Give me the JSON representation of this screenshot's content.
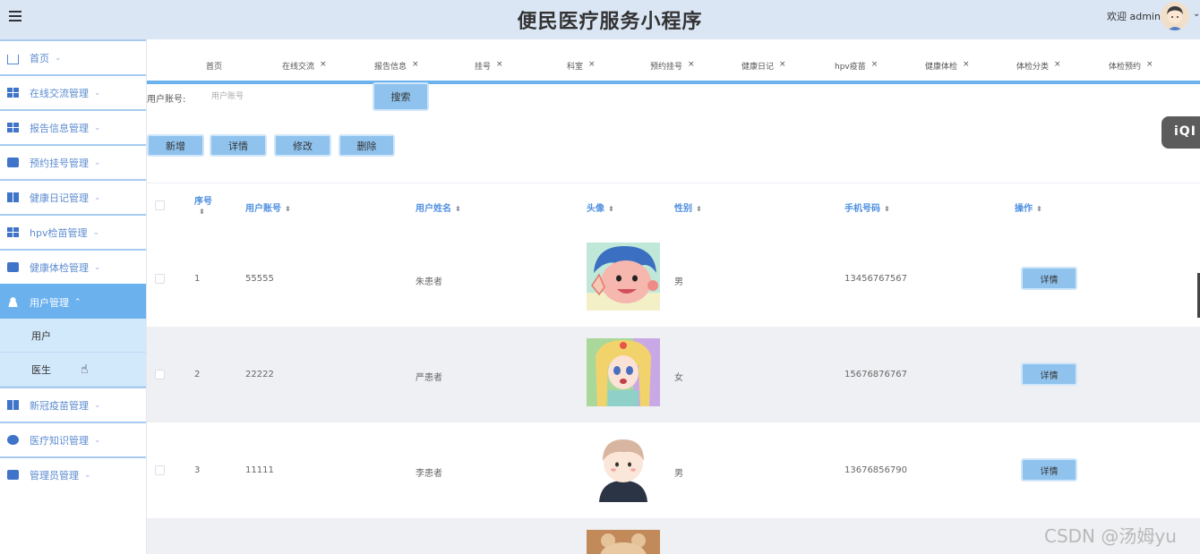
{
  "header": {
    "title": "便民医疗服务小程序",
    "welcome": "欢迎 admin",
    "avatar_icon": "user-avatar-icon",
    "menu_icon": "menu-toggle-icon"
  },
  "sidebar": {
    "items": [
      {
        "label": "首页",
        "icon": "home-icon"
      },
      {
        "label": "在线交流管理",
        "icon": "grid-icon"
      },
      {
        "label": "报告信息管理",
        "icon": "grid-icon"
      },
      {
        "label": "预约挂号管理",
        "icon": "ticket-icon"
      },
      {
        "label": "健康日记管理",
        "icon": "grid-icon"
      },
      {
        "label": "hpv检苗管理",
        "icon": "grid-icon"
      },
      {
        "label": "健康体检管理",
        "icon": "copy-icon"
      },
      {
        "label": "用户管理",
        "icon": "user-icon"
      },
      {
        "label": "新冠疫苗管理",
        "icon": "grid-icon"
      },
      {
        "label": "医疗知识管理",
        "icon": "shield-icon"
      },
      {
        "label": "管理员管理",
        "icon": "briefcase-icon"
      }
    ],
    "user_sub": [
      "用户",
      "医生"
    ]
  },
  "tabs": [
    {
      "label": "首页"
    },
    {
      "label": "在线交流"
    },
    {
      "label": "报告信息"
    },
    {
      "label": "挂号"
    },
    {
      "label": "科室"
    },
    {
      "label": "预约挂号"
    },
    {
      "label": "健康日记"
    },
    {
      "label": "hpv疫苗"
    },
    {
      "label": "健康体检"
    },
    {
      "label": "体检分类"
    },
    {
      "label": "体检预约"
    }
  ],
  "tab_close": "×",
  "search": {
    "label": "用户账号:",
    "placeholder": "用户账号",
    "button": "搜索"
  },
  "actions": {
    "add": "新增",
    "detail": "详情",
    "edit": "修改",
    "delete": "删除"
  },
  "float_badge": "iQI",
  "table": {
    "headers": {
      "index": "序号",
      "account": "用户账号",
      "name": "用户姓名",
      "avatar": "头像",
      "gender": "性别",
      "phone": "手机号码",
      "ops": "操作"
    },
    "sort_glyph": "⬍",
    "rows": [
      {
        "index": "1",
        "account": "55555",
        "name": "朱患者",
        "gender": "男",
        "phone": "13456767567",
        "op": "详情"
      },
      {
        "index": "2",
        "account": "22222",
        "name": "严患者",
        "gender": "女",
        "phone": "15676876767",
        "op": "详情"
      },
      {
        "index": "3",
        "account": "11111",
        "name": "李患者",
        "gender": "男",
        "phone": "13676856790",
        "op": "详情"
      }
    ]
  },
  "watermark": "CSDN @汤姆yu",
  "colors": {
    "header_bg": "#dbe6f5",
    "sidebar_active": "#6ab1ee",
    "button_bg": "#8fc3ee",
    "header_text": "#4e8fe0"
  }
}
